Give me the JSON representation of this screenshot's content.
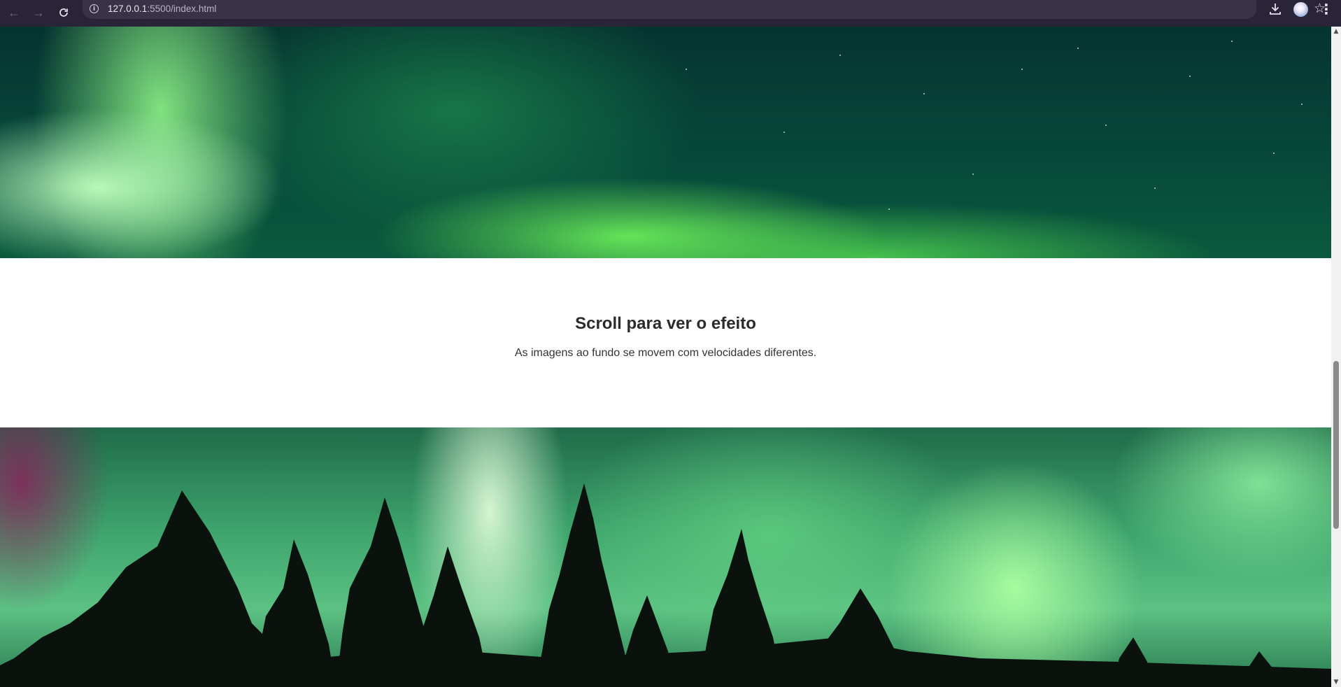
{
  "browser": {
    "back_icon": "arrow-left-icon",
    "forward_icon": "arrow-right-icon",
    "reload_icon": "reload-icon",
    "url_host": "127.0.0.1",
    "url_path": ":5500/index.html",
    "bookmark_icon": "star-icon",
    "download_icon": "download-icon",
    "menu_icon": "more-vert-icon"
  },
  "page": {
    "heading": "Scroll para ver o efeito",
    "description": "As imagens ao fundo se movem com velocidades diferentes."
  },
  "colors": {
    "chrome_bg": "#2a2438",
    "omnibox_bg": "#3a3348",
    "page_bg": "#ffffff",
    "aurora_green": "#5cc183"
  }
}
